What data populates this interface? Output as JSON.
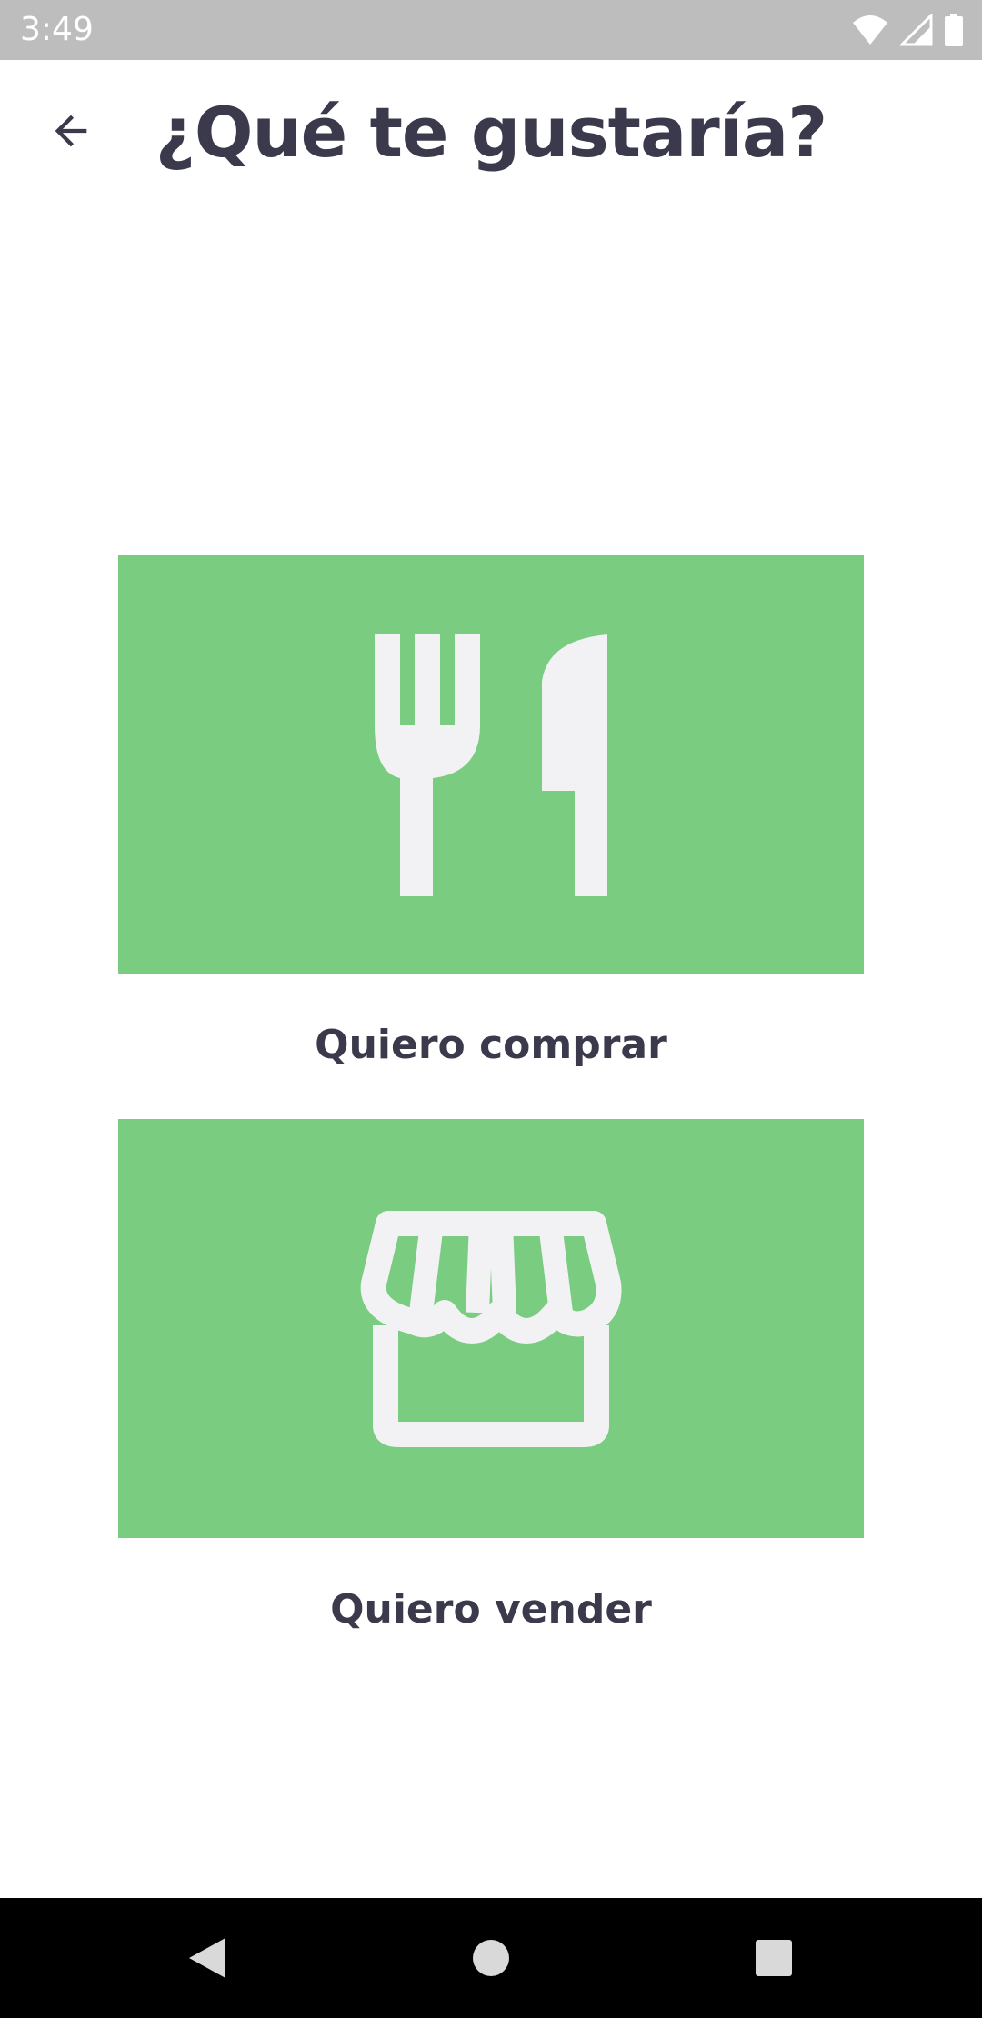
{
  "status_bar": {
    "time": "3:49",
    "icons": [
      "wifi-icon",
      "signal-icon",
      "battery-icon"
    ]
  },
  "header": {
    "title": "¿Qué te gustaría?",
    "back_icon": "arrow-left-icon"
  },
  "options": [
    {
      "label": "Quiero comprar",
      "icon": "fork-knife-icon"
    },
    {
      "label": "Quiero vender",
      "icon": "storefront-icon"
    }
  ],
  "nav_bar": {
    "icons": [
      "nav-back-icon",
      "nav-home-icon",
      "nav-recents-icon"
    ]
  },
  "colors": {
    "card": "#7acc80",
    "icon": "#f2f2f5",
    "text": "#3a3a4c",
    "status_bar": "#bdbdbd"
  }
}
